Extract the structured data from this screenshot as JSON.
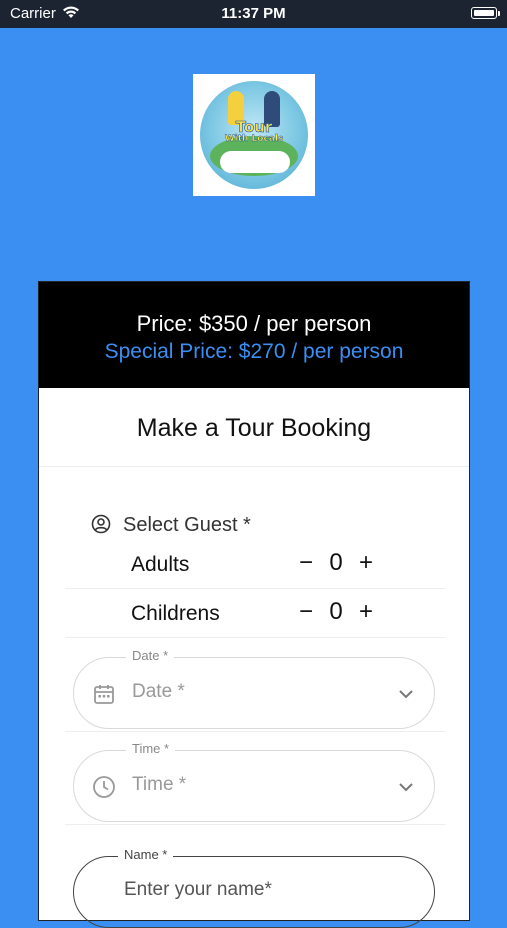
{
  "status_bar": {
    "carrier": "Carrier",
    "time": "11:37 PM"
  },
  "logo": {
    "line1": "Tour",
    "line2": "With Locals"
  },
  "price": {
    "regular": "Price: $350 / per person",
    "special": "Special Price: $270 / per person"
  },
  "form": {
    "title": "Make a Tour Booking",
    "guest_label": "Select Guest *",
    "adults": {
      "label": "Adults",
      "minus": "−",
      "value": "0",
      "plus": "+"
    },
    "childrens": {
      "label": "Childrens",
      "minus": "−",
      "value": "0",
      "plus": "+"
    },
    "date": {
      "floating_label": "Date *",
      "placeholder": "Date *"
    },
    "time": {
      "floating_label": "Time *",
      "placeholder": "Time *"
    },
    "name": {
      "floating_label": "Name *",
      "placeholder": "Enter your name*"
    }
  },
  "colors": {
    "background": "#3b8ef2",
    "special_price": "#3b8ef2",
    "header_bg": "#000000"
  },
  "icons": {
    "guest": "person-circle-icon",
    "date": "calendar-icon",
    "time": "clock-icon",
    "dropdown": "chevron-down-icon"
  }
}
